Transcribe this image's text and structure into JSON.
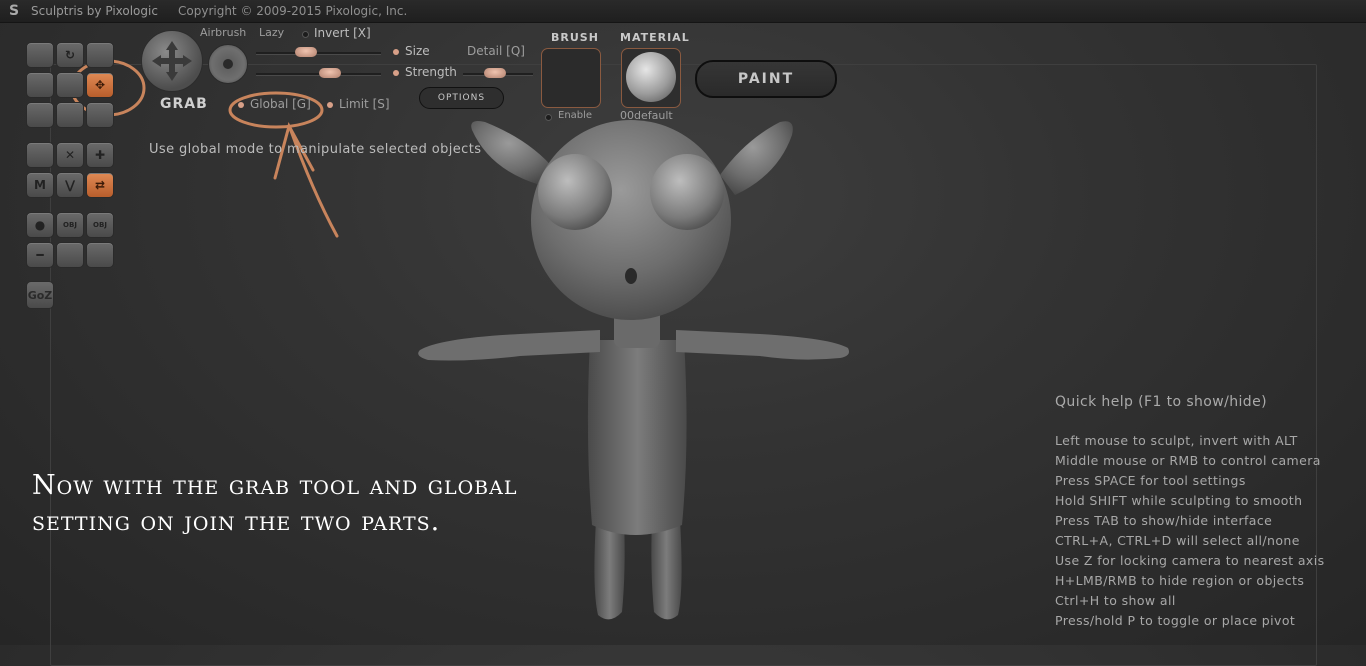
{
  "window": {
    "app_title": "Sculptris by Pixologic",
    "copyright": "Copyright © 2009-2015 Pixologic, Inc."
  },
  "toolbar": {
    "tools": [
      {
        "name": "draw-tool",
        "glyph": ""
      },
      {
        "name": "rotate-tool",
        "glyph": "↻"
      },
      {
        "name": "crease-tool",
        "glyph": ""
      },
      {
        "name": "flatten-tool",
        "glyph": ""
      },
      {
        "name": "inflate-tool",
        "glyph": ""
      },
      {
        "name": "grab-tool",
        "glyph": "✥"
      },
      {
        "name": "pinch-tool",
        "glyph": ""
      },
      {
        "name": "smooth-tool",
        "glyph": ""
      },
      {
        "name": "layer-tool",
        "glyph": ""
      },
      {
        "name": "symmetry-tool",
        "glyph": ""
      },
      {
        "name": "wireframe-tool",
        "glyph": "✕"
      },
      {
        "name": "grid-tool",
        "glyph": "✚"
      },
      {
        "name": "mask-tool",
        "glyph": "M"
      },
      {
        "name": "reduce-tool",
        "glyph": "⋁"
      },
      {
        "name": "move-selection-tool",
        "glyph": "⇄"
      },
      {
        "name": "new-sphere-tool",
        "glyph": "●"
      },
      {
        "name": "import-obj-tool",
        "glyph": "OBJ"
      },
      {
        "name": "export-obj-tool",
        "glyph": "OBJ"
      },
      {
        "name": "new-plane-tool",
        "glyph": "━"
      },
      {
        "name": "open-file-tool",
        "glyph": ""
      },
      {
        "name": "save-file-tool",
        "glyph": ""
      }
    ],
    "goz_label": "GoZ"
  },
  "tool_settings": {
    "tool_name": "GRAB",
    "airbrush_label": "Airbrush",
    "lazy_label": "Lazy",
    "invert_label": "Invert [X]",
    "size_label": "Size",
    "strength_label": "Strength",
    "detail_label": "Detail [Q]",
    "global_label": "Global [G]",
    "limit_label": "Limit [S]",
    "options_label": "OPTIONS",
    "size_value": 0.34,
    "strength_value": 0.55,
    "detail_value": 0.5
  },
  "brush": {
    "label": "BRUSH",
    "enable_label": "Enable"
  },
  "material": {
    "label": "MATERIAL",
    "name": "00default"
  },
  "paint_button": "PAINT",
  "hint": "Use global mode to manipulate selected objects",
  "quick_help": {
    "title": "Quick help (F1 to show/hide)",
    "items": [
      "Left mouse to sculpt, invert with ALT",
      "Middle mouse or RMB to control camera",
      "Press SPACE for tool settings",
      "Hold SHIFT while sculpting to smooth",
      "Press TAB to show/hide interface",
      "CTRL+A, CTRL+D will select all/none",
      "Use Z for locking camera to nearest axis",
      "H+LMB/RMB to hide region or objects",
      "Ctrl+H to show all",
      "Press/hold P to toggle or place pivot"
    ]
  },
  "caption": "Now with the grab tool and global setting on join the two parts.",
  "colors": {
    "annotation": "#c8845c",
    "active_tool": "#d0743f",
    "caption": "#ffffff"
  }
}
